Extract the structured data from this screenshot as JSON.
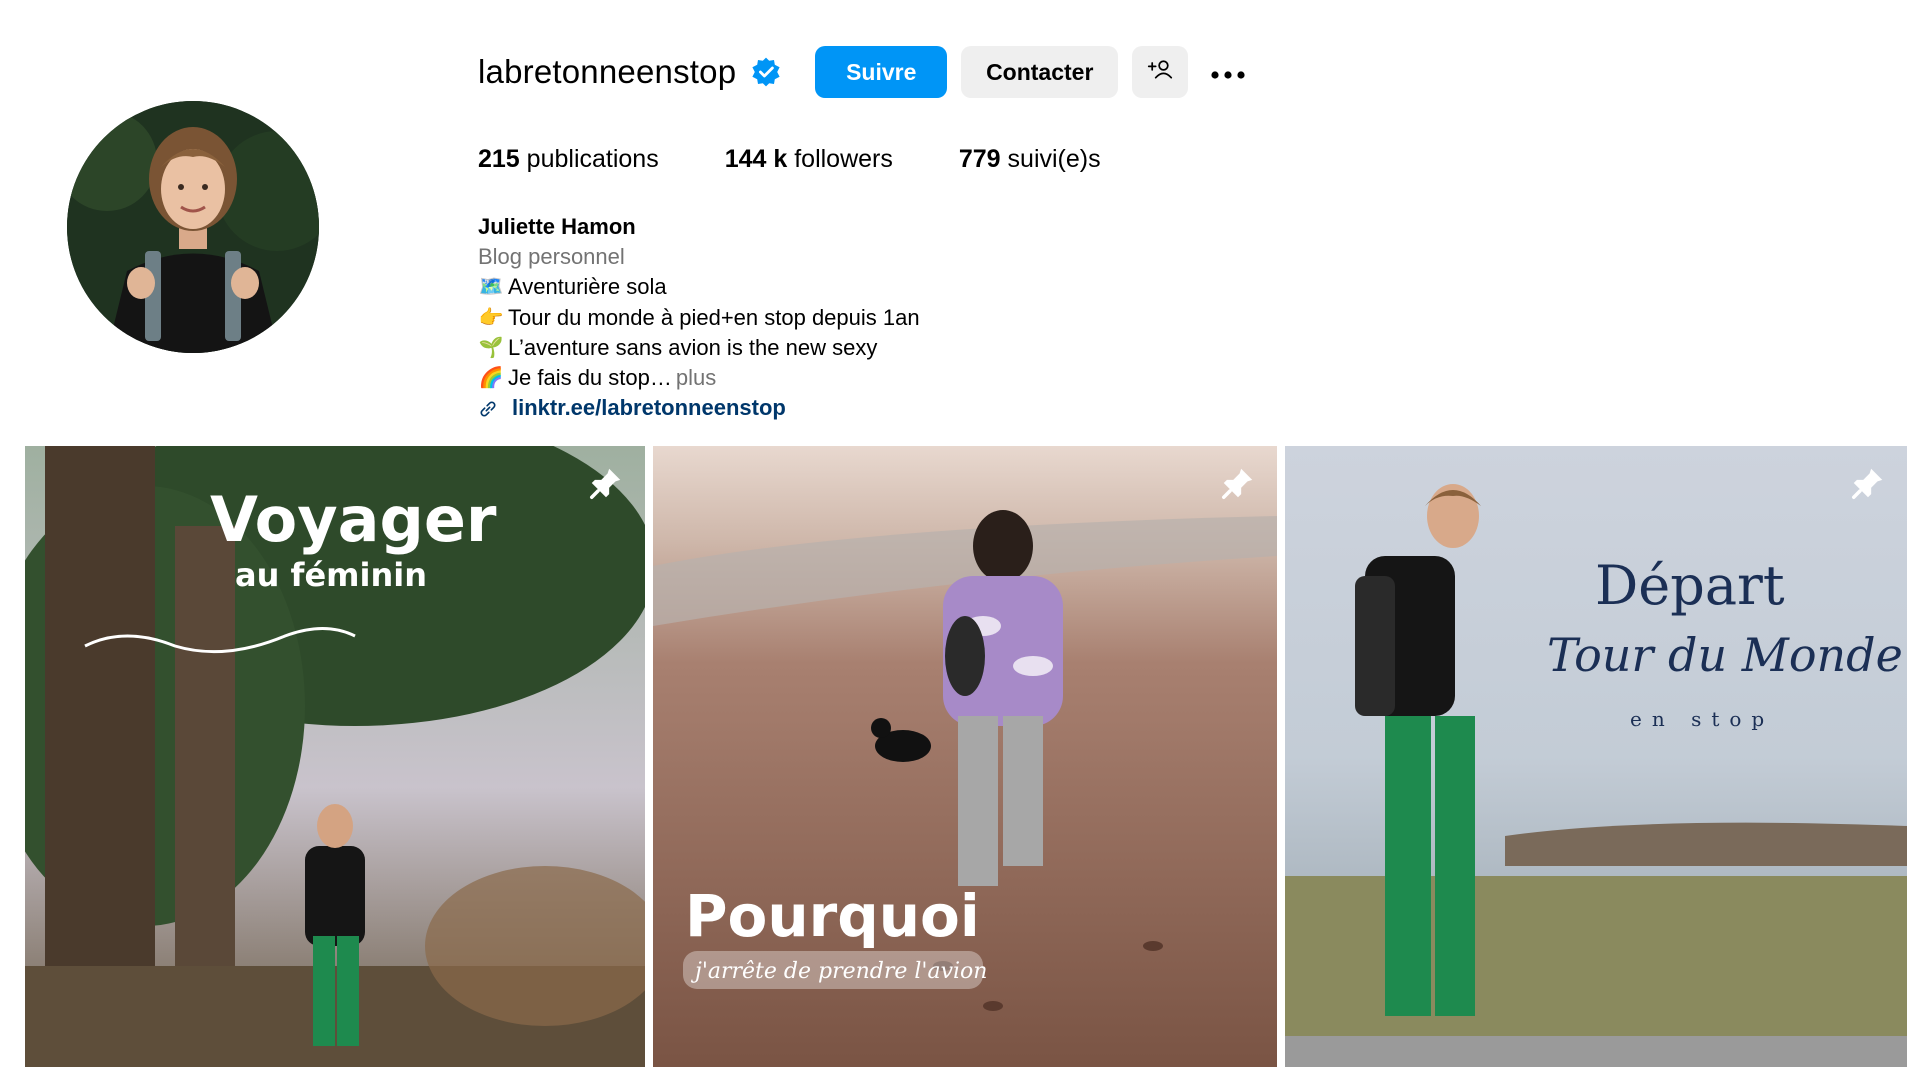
{
  "profile": {
    "username": "labretonneenstop",
    "verified_icon": "verified-badge-icon",
    "follow_label": "Suivre",
    "contact_label": "Contacter",
    "suggest_icon": "add-person-icon",
    "more_icon": "more-options-icon",
    "accent_color": "#0095f6"
  },
  "stats": {
    "posts_count": "215",
    "posts_label": "publications",
    "followers_count": "144 k",
    "followers_label": "followers",
    "following_count": "779",
    "following_label": "suivi(e)s"
  },
  "bio": {
    "name": "Juliette Hamon",
    "category": "Blog personnel",
    "lines": [
      {
        "emoji": "🗺️",
        "text": "Aventurière sola"
      },
      {
        "emoji": "👉",
        "text": " Tour du monde à pied+en stop depuis 1an"
      },
      {
        "emoji": "🌱",
        "text": "L’aventure sans avion is the new sexy"
      },
      {
        "emoji": "🌈",
        "text": "Je fais du stop…"
      }
    ],
    "more_label": "plus",
    "link": "linktr.ee/labretonneenstop"
  },
  "posts": [
    {
      "title": "Voyager",
      "subtitle": "au féminin",
      "pin_icon": "pin-icon"
    },
    {
      "title": "Pourquoi",
      "subtitle": "j'arrête de prendre l'avion",
      "pin_icon": "pin-icon"
    },
    {
      "title": "Départ",
      "subtitle": "Tour du Monde",
      "caption": "en stop",
      "pin_icon": "pin-icon"
    }
  ]
}
